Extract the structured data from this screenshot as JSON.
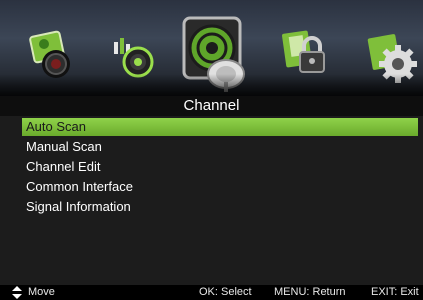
{
  "icons": [
    {
      "name": "picture-icon"
    },
    {
      "name": "sound-icon"
    },
    {
      "name": "channel-satellite-icon"
    },
    {
      "name": "lock-icon"
    },
    {
      "name": "setup-gear-icon"
    }
  ],
  "title": "Channel",
  "menu": {
    "items": [
      {
        "label": "Auto Scan",
        "selected": true
      },
      {
        "label": "Manual Scan",
        "selected": false
      },
      {
        "label": "Channel Edit",
        "selected": false
      },
      {
        "label": "Common Interface",
        "selected": false
      },
      {
        "label": "Signal Information",
        "selected": false
      }
    ]
  },
  "footer": {
    "move": "Move",
    "ok": "OK: Select",
    "menu": "MENU: Return",
    "exit": "EXIT: Exit"
  },
  "colors": {
    "highlight": "#7cbf3a",
    "background": "#1c1c1c"
  }
}
